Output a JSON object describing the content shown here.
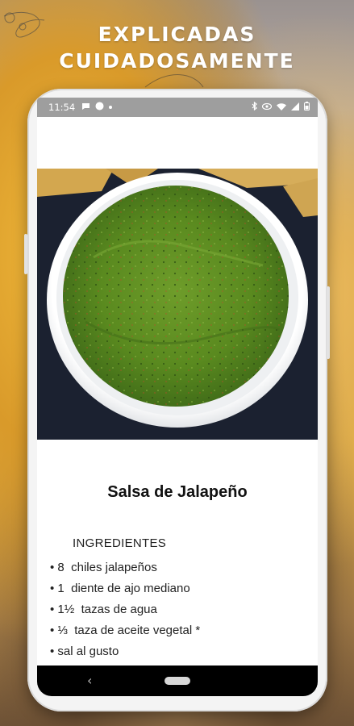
{
  "promo": {
    "headline": [
      "EXPLICADAS",
      "CUIDADOSAMENTE"
    ]
  },
  "statusbar": {
    "time": "11:54",
    "left_icons": [
      "chat-icon",
      "circle-icon",
      "dot-icon"
    ],
    "right_icons": [
      "bluetooth-icon",
      "eye-icon",
      "wifi-icon",
      "signal-icon",
      "battery-icon"
    ]
  },
  "recipe": {
    "title": "Salsa de Jalapeño",
    "image": "salsa-verde-bowl-photo",
    "ingredients_heading": "INGREDIENTES",
    "ingredients": [
      "• 8  chiles jalapeños",
      "• 1  diente de ajo mediano",
      "• 1½  tazas de agua",
      "• ⅓  taza de aceite vegetal *",
      "• sal al gusto"
    ]
  },
  "navbar": {
    "back_glyph": "‹"
  },
  "colors": {
    "status_bar": "#9e9e9e",
    "salsa": "#5f8f22",
    "bowl": "#f5f5f5",
    "nav_bar": "#000000"
  }
}
